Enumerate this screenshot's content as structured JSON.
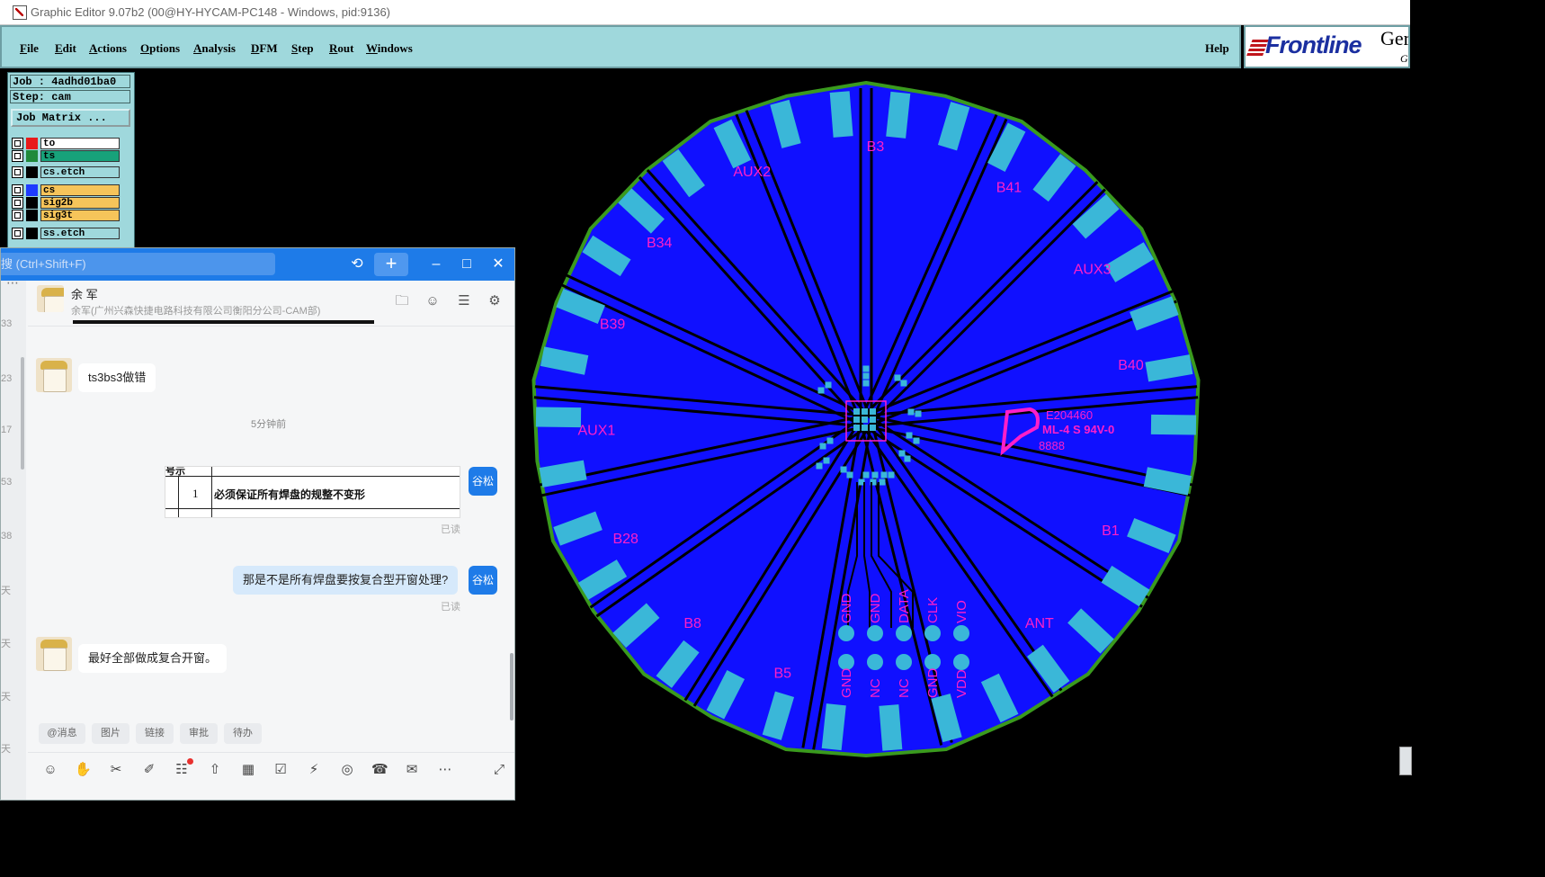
{
  "window": {
    "title": "Graphic Editor 9.07b2 (00@HY-HYCAM-PC148 - Windows, pid:9136)"
  },
  "menu": {
    "items": [
      {
        "label": "File",
        "u": "F",
        "rest": "ile"
      },
      {
        "label": "Edit",
        "u": "E",
        "rest": "dit"
      },
      {
        "label": "Actions",
        "u": "A",
        "rest": "ctions"
      },
      {
        "label": "Options",
        "u": "O",
        "rest": "ptions"
      },
      {
        "label": "Analysis",
        "u": "A",
        "rest": "nalysis"
      },
      {
        "label": "DFM",
        "u": "D",
        "rest": "FM"
      },
      {
        "label": "Step",
        "u": "S",
        "rest": "tep"
      },
      {
        "label": "Rout",
        "u": "R",
        "rest": "out"
      },
      {
        "label": "Windows",
        "u": "W",
        "rest": "indows"
      }
    ],
    "help": "Help"
  },
  "logo": {
    "brand": "Frontline",
    "suffix": "Ger",
    "suffix2": "G"
  },
  "job_panel": {
    "job": "Job : 4adhd01ba0",
    "step": "Step: cam",
    "matrix_button": "Job Matrix ...",
    "layers": [
      {
        "name": "to",
        "swatch": "#e81b1b",
        "bg": "#ffffff",
        "mark": true
      },
      {
        "name": "ts",
        "swatch": "#1f8a3a",
        "bg": "#17a27a",
        "mark": false
      },
      {
        "name": "cs.etch",
        "swatch": "#000000",
        "bg": "#9fd8dc",
        "mark": false
      },
      {
        "name": "cs",
        "swatch": "#1e3bff",
        "bg": "#f6c45a",
        "mark": false
      },
      {
        "name": "sig2b",
        "swatch": "#000000",
        "bg": "#f6c45a",
        "mark": false
      },
      {
        "name": "sig3t",
        "swatch": "#000000",
        "bg": "#f6c45a",
        "mark": false
      },
      {
        "name": "ss.etch",
        "swatch": "#000000",
        "bg": "#9fd8dc",
        "mark": false
      }
    ]
  },
  "pcb": {
    "colors": {
      "board": "#1010ff",
      "outline": "#3a9a1e",
      "pad": "#3ab7d8",
      "label": "#ff1fc9",
      "trace": "#000000"
    },
    "antenna_labels": [
      {
        "text": "B3",
        "angle": -88
      },
      {
        "text": "B41",
        "angle": -58
      },
      {
        "text": "AUX3",
        "angle": -33
      },
      {
        "text": "B40",
        "angle": -11
      },
      {
        "text": "B1",
        "angle": 25
      },
      {
        "text": "ANT",
        "angle": 50
      },
      {
        "text": "B5",
        "angle": 108
      },
      {
        "text": "B8",
        "angle": 130
      },
      {
        "text": "B28",
        "angle": 153
      },
      {
        "text": "AUX1",
        "angle": 177
      },
      {
        "text": "B39",
        "angle": -160
      },
      {
        "text": "B34",
        "angle": -140
      },
      {
        "text": "AUX2",
        "angle": -115
      }
    ],
    "pin_top": [
      "GND",
      "GND",
      "DATA",
      "CLK",
      "VIO"
    ],
    "pin_bottom": [
      "GND",
      "NC",
      "NC",
      "GND",
      "VDD"
    ],
    "marking": {
      "line1": "E204460",
      "line2": "ML-4 S 94V-0",
      "line3": "8888"
    }
  },
  "chat": {
    "search_placeholder": "搜 (Ctrl+Shift+F)",
    "user_name": "余 军",
    "user_org": "余军(广州兴森快捷电路科技有限公司衡阳分公司-CAM部)",
    "sidebar_numbers": [
      "33",
      "23",
      "17",
      "53",
      "38",
      "天",
      "天",
      "天",
      "天"
    ],
    "messages": {
      "m1": "ts3bs3做错",
      "time": "5分钟前",
      "img_top": "号示",
      "img_num": "1",
      "img_text": "必须保证所有焊盘的规整不变形",
      "me_name": "谷松",
      "read": "已读",
      "m2": "那是不是所有焊盘要按复合型开窗处理?",
      "m3": "最好全部做成复合开窗。"
    },
    "chips": [
      "@消息",
      "图片",
      "链接",
      "审批",
      "待办"
    ],
    "toolbar_icons": [
      "emoji-icon",
      "thumbs-up-icon",
      "scissors-icon",
      "note-icon",
      "task-icon",
      "upload-icon",
      "calendar-icon",
      "check-icon",
      "lightning-icon",
      "screen-share-icon",
      "phone-icon",
      "mail-icon",
      "more-icon",
      "expand-icon"
    ]
  }
}
